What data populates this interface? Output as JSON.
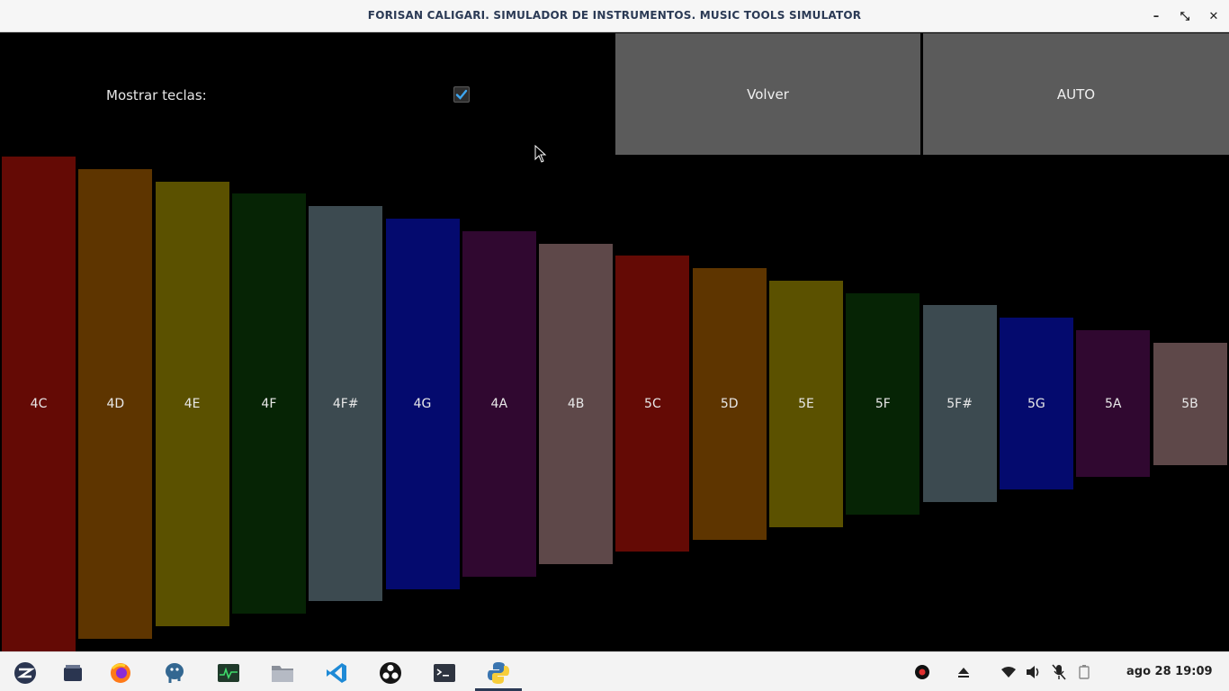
{
  "window": {
    "title": "FORISAN CALIGARI. SIMULADOR DE INSTRUMENTOS. MUSIC TOOLS SIMULATOR",
    "minimize": "–",
    "maximize": "⤡",
    "close": "✕"
  },
  "controls": {
    "show_keys_label": "Mostrar teclas:",
    "show_keys_checked": true,
    "back_button": "Volver",
    "auto_button": "AUTO"
  },
  "keys": [
    {
      "label": "4C",
      "color": "#640a05"
    },
    {
      "label": "4D",
      "color": "#5e3500"
    },
    {
      "label": "4E",
      "color": "#5b5100"
    },
    {
      "label": "4F",
      "color": "#062405"
    },
    {
      "label": "4F#",
      "color": "#3c4a50"
    },
    {
      "label": "4G",
      "color": "#040a6e"
    },
    {
      "label": "4A",
      "color": "#300830"
    },
    {
      "label": "4B",
      "color": "#5e4849"
    },
    {
      "label": "5C",
      "color": "#640a05"
    },
    {
      "label": "5D",
      "color": "#5e3500"
    },
    {
      "label": "5E",
      "color": "#5b5100"
    },
    {
      "label": "5F",
      "color": "#062405"
    },
    {
      "label": "5F#",
      "color": "#3c4a50"
    },
    {
      "label": "5G",
      "color": "#040a6e"
    },
    {
      "label": "5A",
      "color": "#300830"
    },
    {
      "label": "5B",
      "color": "#5e4849"
    }
  ],
  "taskbar": {
    "apps": [
      "zorin-menu-icon",
      "files-window-icon",
      "firefox-icon",
      "pgadmin-icon",
      "system-monitor-icon",
      "file-manager-icon",
      "vscode-icon",
      "obs-icon",
      "terminal-icon",
      "python-icon"
    ],
    "tray": [
      "record-icon",
      "eject-icon",
      "wifi-icon",
      "volume-icon",
      "mic-muted-icon",
      "battery-icon"
    ],
    "clock": "ago 28  19:09"
  }
}
